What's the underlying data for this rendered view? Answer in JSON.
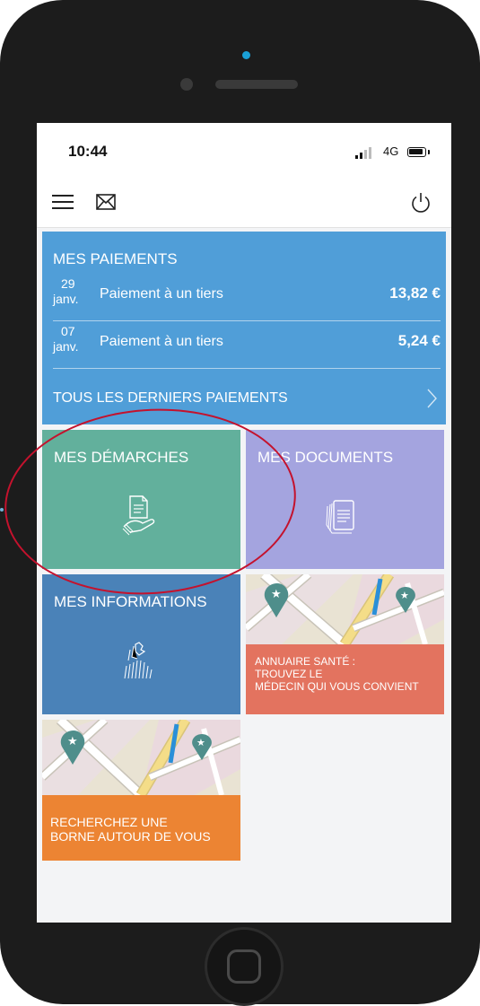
{
  "status": {
    "time": "10:44",
    "network": "4G"
  },
  "navbar": {
    "menu_icon": "hamburger-menu-icon",
    "mail_icon": "envelope-icon",
    "power_icon": "power-icon"
  },
  "payments": {
    "title": "MES PAIEMENTS",
    "items": [
      {
        "day": "29",
        "month": "janv.",
        "label": "Paiement à un tiers",
        "amount": "13,82 €"
      },
      {
        "day": "07",
        "month": "janv.",
        "label": "Paiement à un tiers",
        "amount": "5,24 €"
      }
    ],
    "all_label": "TOUS LES DERNIERS PAIEMENTS",
    "color": "#509ed8"
  },
  "tiles": {
    "demarches": {
      "title": "MES DÉMARCHES",
      "icon": "hand-document-icon",
      "color": "#62b09c"
    },
    "documents": {
      "title": "MES DOCUMENTS",
      "icon": "documents-stack-icon",
      "color": "#a4a4df"
    },
    "informations": {
      "title": "MES INFORMATIONS",
      "icon": "person-profile-icon",
      "color": "#4a82b8"
    },
    "annuaire": {
      "line1": "ANNUAIRE SANTÉ :",
      "line2": "TROUVEZ LE",
      "line3": "MÉDECIN QUI VOUS CONVIENT",
      "icon": "map-icon",
      "color": "#e3735f"
    },
    "borne": {
      "line1": "RECHERCHEZ UNE",
      "line2": "BORNE AUTOUR DE VOUS",
      "icon": "map-icon",
      "color": "#ec8433"
    }
  },
  "annotation": {
    "color": "#c4122d"
  }
}
